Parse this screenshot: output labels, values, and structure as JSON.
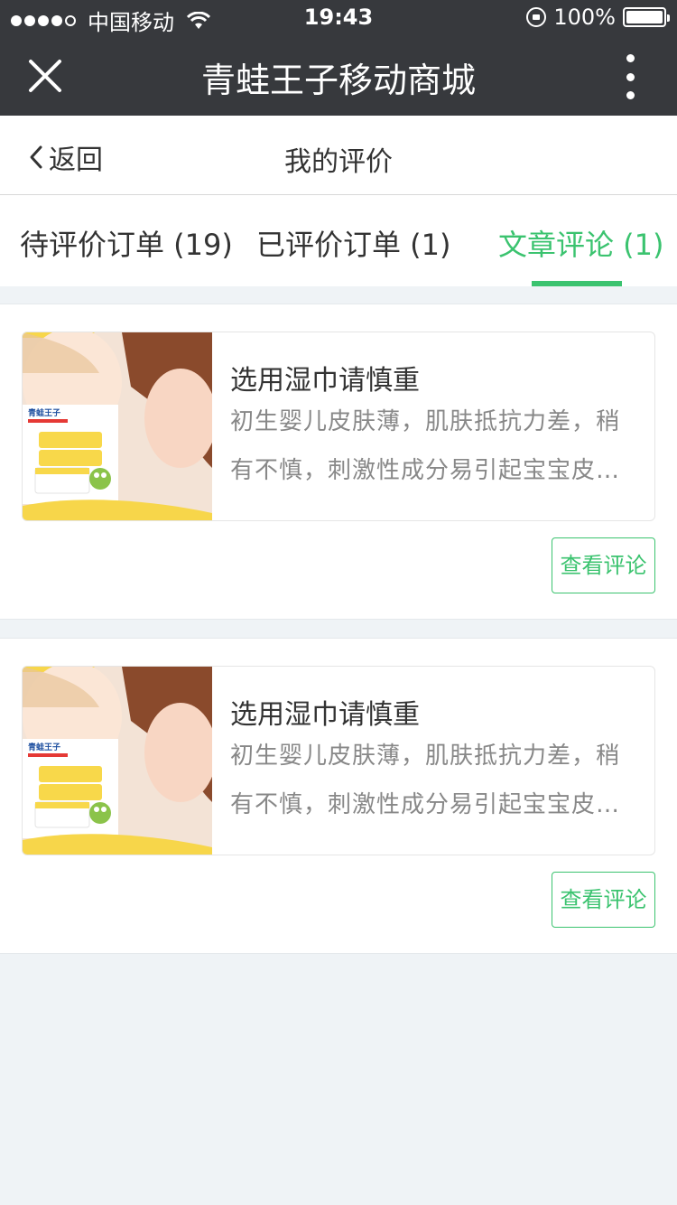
{
  "status_bar": {
    "carrier": "中国移动",
    "time": "19:43",
    "battery": "100%",
    "battery_level": 1.0,
    "signal_dots_filled": 4
  },
  "navbar": {
    "title": "青蛙王子移动商城",
    "close_icon": "close-icon",
    "more_icon": "more-vertical-icon"
  },
  "subheader": {
    "back_label": "返回",
    "title": "我的评价"
  },
  "tabs": [
    {
      "label": "待评价订单 (19)",
      "active": false
    },
    {
      "label": "已评价订单 (1)",
      "active": false
    },
    {
      "label": "文章评论 (1)",
      "active": true
    }
  ],
  "accent_color": "#3bc36f",
  "articles": [
    {
      "title": "选用湿巾请慎重",
      "desc": "初生婴儿皮肤薄，肌肤抵抗力差，稍有不慎，刺激性成分易引起宝宝皮…",
      "button_label": "查看评论",
      "thumb_brand": "青蛙王子"
    },
    {
      "title": "选用湿巾请慎重",
      "desc": "初生婴儿皮肤薄，肌肤抵抗力差，稍有不慎，刺激性成分易引起宝宝皮…",
      "button_label": "查看评论",
      "thumb_brand": "青蛙王子"
    }
  ]
}
